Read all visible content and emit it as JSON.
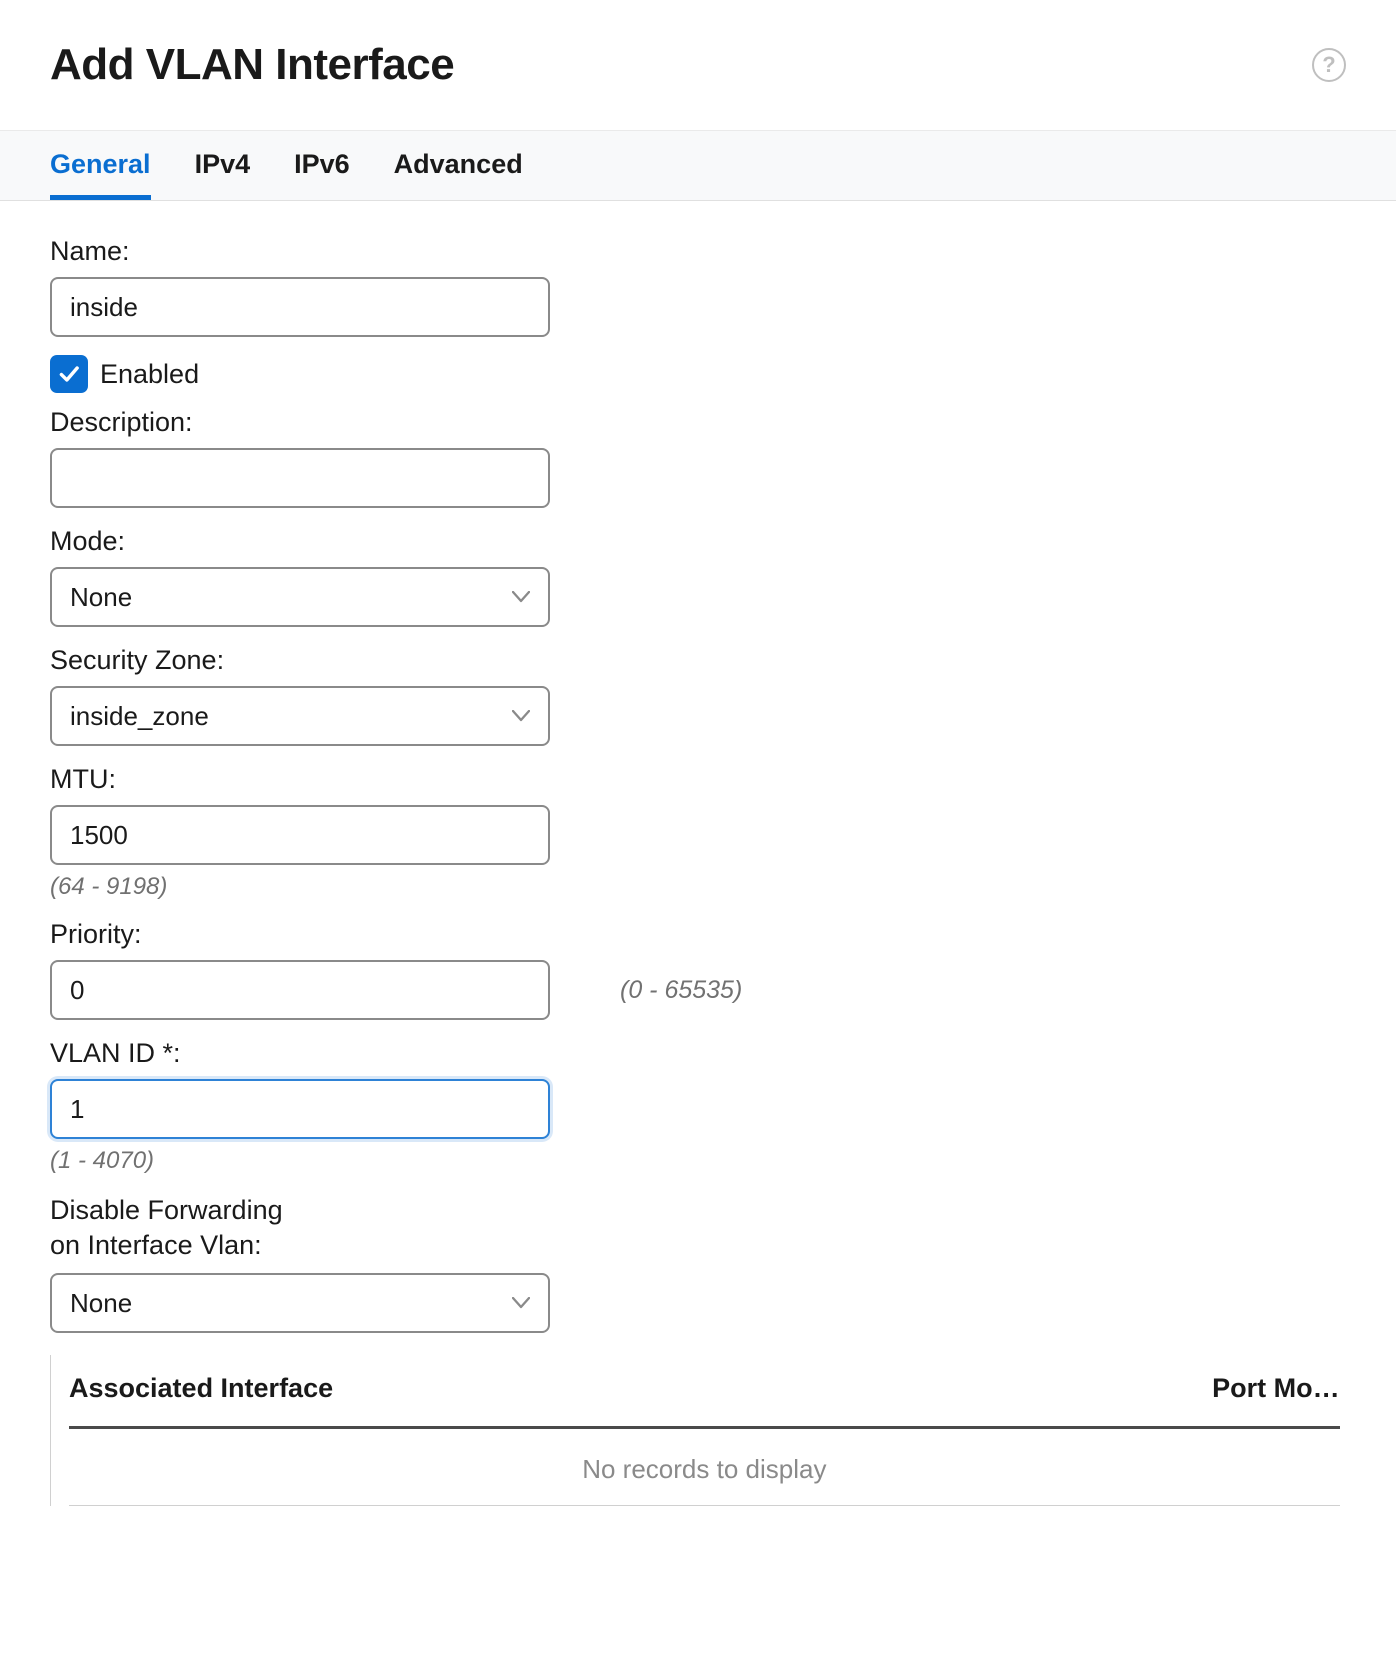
{
  "header": {
    "title": "Add VLAN Interface"
  },
  "tabs": [
    {
      "label": "General",
      "active": true
    },
    {
      "label": "IPv4",
      "active": false
    },
    {
      "label": "IPv6",
      "active": false
    },
    {
      "label": "Advanced",
      "active": false
    }
  ],
  "form": {
    "name_label": "Name:",
    "name_value": "inside",
    "enabled_label": "Enabled",
    "enabled_checked": true,
    "description_label": "Description:",
    "description_value": "",
    "mode_label": "Mode:",
    "mode_value": "None",
    "zone_label": "Security Zone:",
    "zone_value": "inside_zone",
    "mtu_label": "MTU:",
    "mtu_value": "1500",
    "mtu_hint": "(64 - 9198)",
    "priority_label": "Priority:",
    "priority_value": "0",
    "priority_hint": "(0 - 65535)",
    "vlanid_label": "VLAN ID *:",
    "vlanid_value": "1",
    "vlanid_hint": "(1 - 4070)",
    "disable_fwd_label": "Disable Forwarding\non Interface Vlan:",
    "disable_fwd_value": "None"
  },
  "table": {
    "col1": "Associated Interface",
    "col2": "Port Mo…",
    "empty": "No records to display"
  }
}
